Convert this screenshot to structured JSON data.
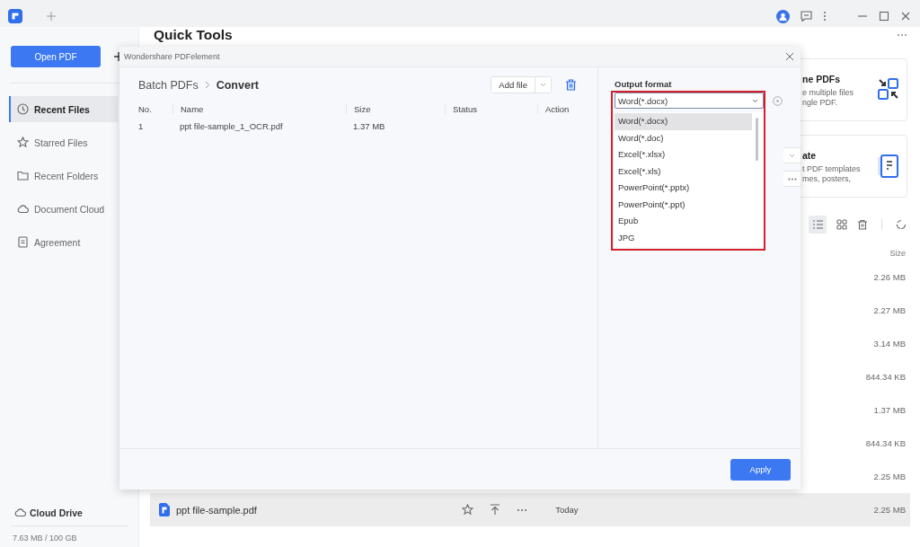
{
  "sidebar": {
    "open_button": "Open PDF",
    "items": [
      {
        "label": "Recent Files",
        "kind": "clock",
        "selected": true
      },
      {
        "label": "Starred Files",
        "kind": "star",
        "selected": false
      },
      {
        "label": "Recent Folders",
        "kind": "folder",
        "selected": false
      },
      {
        "label": "Document Cloud",
        "kind": "cloud",
        "selected": false
      },
      {
        "label": "Agreement",
        "kind": "document",
        "selected": false
      }
    ],
    "cloud": {
      "label": "Cloud Drive",
      "usage": "7.63 MB / 100 GB"
    }
  },
  "main": {
    "title": "Quick Tools",
    "cards": [
      {
        "kind": "combine",
        "title": "ne PDFs",
        "lines": [
          "e multiple files",
          "ngle PDF."
        ]
      },
      {
        "kind": "template",
        "title": "ate",
        "lines": [
          "t PDF templates",
          "mes, posters,"
        ]
      }
    ],
    "size_header": "Size",
    "files": [
      {
        "size": "2.26 MB",
        "selected": false
      },
      {
        "size": "2.27 MB",
        "selected": false
      },
      {
        "size": "3.14 MB",
        "selected": false
      },
      {
        "size": "844.34 KB",
        "selected": false
      },
      {
        "size": "1.37 MB",
        "selected": false
      },
      {
        "size": "844.34 KB",
        "selected": false
      },
      {
        "size": "2.25 MB",
        "selected": false
      },
      {
        "name": "ppt file-sample.pdf",
        "date": "Today",
        "size": "2.25 MB",
        "selected": true
      }
    ]
  },
  "dialog": {
    "title": "Wondershare PDFelement",
    "breadcrumb": [
      "Batch PDFs",
      "Convert"
    ],
    "add_button": "Add file",
    "columns": [
      "No.",
      "Name",
      "Size",
      "Status",
      "Action"
    ],
    "rows": [
      {
        "no": "1",
        "name": "ppt file-sample_1_OCR.pdf",
        "size": "1.37 MB"
      }
    ],
    "output": {
      "label": "Output format",
      "value": "Word(*.docx)",
      "expanded": true,
      "options": [
        {
          "label": "Word(*.docx)",
          "selected": true
        },
        {
          "label": "Word(*.doc)",
          "selected": false
        },
        {
          "label": "Excel(*.xlsx)",
          "selected": false
        },
        {
          "label": "Excel(*.xls)",
          "selected": false
        },
        {
          "label": "PowerPoint(*.pptx)",
          "selected": false
        },
        {
          "label": "PowerPoint(*.ppt)",
          "selected": false
        },
        {
          "label": "Epub",
          "selected": false
        },
        {
          "label": "JPG",
          "selected": false
        }
      ]
    },
    "apply_button": "Apply"
  }
}
